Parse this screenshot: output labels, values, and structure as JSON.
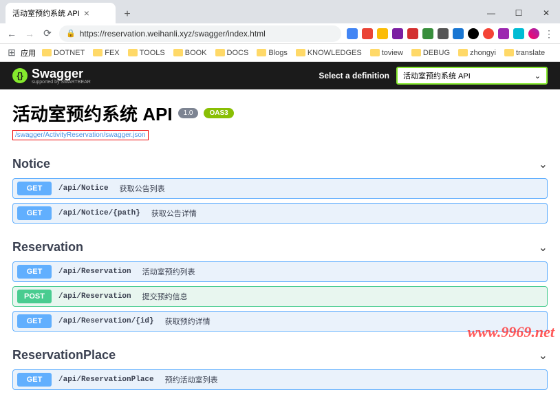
{
  "browser": {
    "tab_title": "活动室预约系统 API",
    "url": "https://reservation.weihanli.xyz/swagger/index.html",
    "bookmarks_label": "应用",
    "bookmarks": [
      "DOTNET",
      "FEX",
      "TOOLS",
      "BOOK",
      "DOCS",
      "Blogs",
      "KNOWLEDGES",
      "toview",
      "DEBUG",
      "zhongyi",
      "translate"
    ]
  },
  "swagger": {
    "brand": "Swagger",
    "supported": "supported by SMARTBEAR",
    "select_label": "Select a definition",
    "select_value": "活动室预约系统 API"
  },
  "api": {
    "title": "活动室预约系统 API",
    "version": "1.0",
    "oas": "OAS3",
    "json_link": "/swagger/ActivityReservation/swagger.json"
  },
  "sections": [
    {
      "name": "Notice",
      "ops": [
        {
          "method": "GET",
          "path": "/api/Notice",
          "summary": "获取公告列表"
        },
        {
          "method": "GET",
          "path": "/api/Notice/{path}",
          "summary": "获取公告详情"
        }
      ]
    },
    {
      "name": "Reservation",
      "ops": [
        {
          "method": "GET",
          "path": "/api/Reservation",
          "summary": "活动室预约列表"
        },
        {
          "method": "POST",
          "path": "/api/Reservation",
          "summary": "提交预约信息"
        },
        {
          "method": "GET",
          "path": "/api/Reservation/{id}",
          "summary": "获取预约详情"
        }
      ]
    },
    {
      "name": "ReservationPlace",
      "ops": [
        {
          "method": "GET",
          "path": "/api/ReservationPlace",
          "summary": "预约活动室列表"
        }
      ]
    }
  ],
  "watermark": "www.9969.net"
}
